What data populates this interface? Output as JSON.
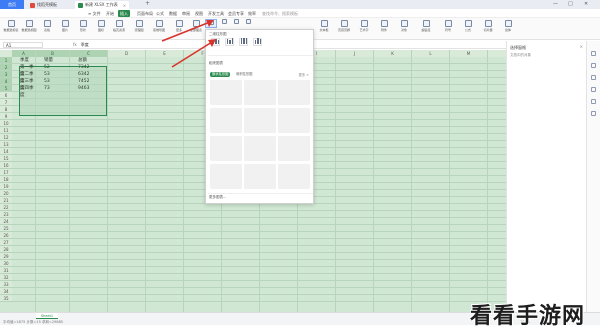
{
  "titlebar": {
    "home": "首页",
    "tabs": [
      {
        "label": "找稻壳模板",
        "color": "#e04a3a"
      },
      {
        "label": "新建 XLSX 工作表",
        "color": "#2a8a4e",
        "active": true
      }
    ],
    "new_tab": "+",
    "controls": [
      "—",
      "□",
      "✕"
    ]
  },
  "menubar": {
    "items": [
      "≡ 文件",
      "开始",
      "插入",
      "页面布局",
      "公式",
      "数据",
      "审阅",
      "视图",
      "开发工具",
      "会员专享",
      "效率"
    ],
    "active_index": 2,
    "search": "查找命令、搜索模板"
  },
  "ribbon": {
    "buttons": [
      "数据透视表",
      "数据透视图",
      "表格",
      "图片",
      "形状",
      "图标",
      "稻壳资源",
      "流程图",
      "思维导图",
      "更多",
      "全部图表",
      "",
      "",
      "",
      "",
      "",
      "",
      "",
      "文本框",
      "页眉页脚",
      "艺术字",
      "附件",
      "对象",
      "超链接",
      "符号",
      "公式",
      "切片器",
      "窗体"
    ]
  },
  "formula": {
    "cell_ref": "A1",
    "fx": "fx",
    "value": "季度"
  },
  "columns": [
    "A",
    "B",
    "C",
    "D",
    "E",
    "F",
    "G",
    "H",
    "I",
    "J",
    "K",
    "L",
    "M"
  ],
  "rows": [
    "1",
    "2",
    "3",
    "4",
    "5",
    "6",
    "7",
    "8",
    "9",
    "10",
    "11",
    "12",
    "13",
    "14",
    "15",
    "16",
    "17",
    "18",
    "19",
    "20",
    "21",
    "22",
    "23",
    "24",
    "25",
    "26",
    "27",
    "28",
    "29",
    "30",
    "31",
    "32",
    "33",
    "34",
    "35"
  ],
  "table": {
    "header": [
      "季度",
      "销量",
      "总额"
    ],
    "data": [
      [
        "第一季度",
        "52",
        "7342"
      ],
      [
        "第二季度",
        "53",
        "6342"
      ],
      [
        "第三季度",
        "53",
        "7452"
      ],
      [
        "第四季度",
        "73",
        "9463"
      ]
    ]
  },
  "chart_dropdown": {
    "section_title": "二维柱形图",
    "templates_title": "稻壳图表",
    "tags": [
      "簇状柱形图",
      "堆积柱形图"
    ],
    "more": "更多 >",
    "footer": "更多图表..."
  },
  "right_panel": {
    "title": "选择窗格",
    "subtitle": "文档中的对象"
  },
  "statusbar": {
    "sheet": "Sheet1",
    "text": "平均值=1875  计数=15  求和=29885",
    "zoom": "100%"
  },
  "watermark": "看看手游网"
}
